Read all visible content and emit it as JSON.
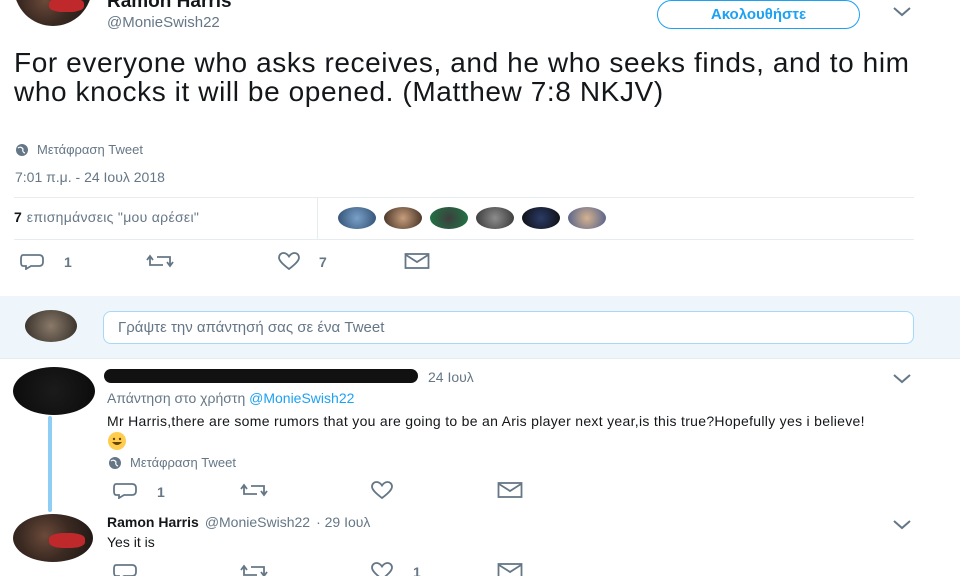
{
  "tweet": {
    "author_name": "Ramon Harris",
    "author_handle": "@MonieSwish22",
    "follow_label": "Ακολουθήστε",
    "text": "For everyone who asks receives, and he who seeks finds, and to him who knocks it will be opened. (Matthew 7:8 NKJV)",
    "translate_label": "Μετάφραση Tweet",
    "timestamp": "7:01 π.μ. - 24 Ιουλ 2018",
    "likes_count": "7",
    "likes_label": "επισημάνσεις \"μου αρέσει\"",
    "actions": {
      "reply_count": "1",
      "retweet_count": "",
      "like_count": "7"
    }
  },
  "reply_box": {
    "placeholder": "Γράψτε την απάντησή σας σε ένα Tweet"
  },
  "replies": [
    {
      "date": "24 Ιουλ",
      "replying_to_label": "Απάντηση στο χρήστη",
      "replying_to_handle": "@MonieSwish22",
      "text": "Mr Harris,there are some rumors that you are going to be an Aris player next year,is this true?Hopefully yes i believe!",
      "emoji": "smiley",
      "translate_label": "Μετάφραση Tweet",
      "actions": {
        "reply_count": "1",
        "retweet_count": "",
        "like_count": ""
      }
    },
    {
      "author_name": "Ramon Harris",
      "author_handle": "@MonieSwish22",
      "date": "· 29 Ιουλ",
      "text": "Yes it is",
      "actions": {
        "reply_count": "",
        "retweet_count": "",
        "like_count": "1"
      }
    }
  ],
  "colors": {
    "accent": "#1da1f2",
    "muted": "#657786",
    "divider": "#e6ecf0",
    "thread_line": "#8ecdf4"
  }
}
